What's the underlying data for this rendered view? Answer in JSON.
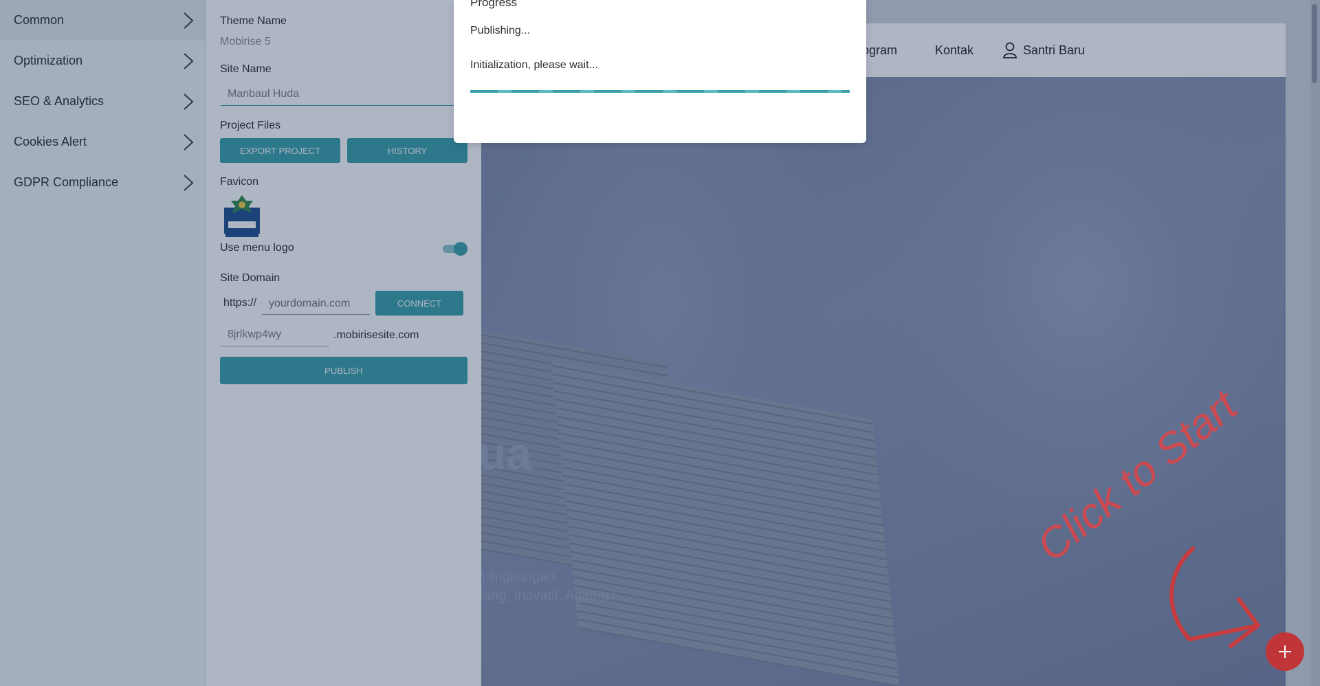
{
  "menu": {
    "items": [
      {
        "label": "Common"
      },
      {
        "label": "Optimization"
      },
      {
        "label": "SEO & Analytics"
      },
      {
        "label": "Cookies Alert"
      },
      {
        "label": "GDPR Compliance"
      }
    ]
  },
  "settings": {
    "theme_name_label": "Theme Name",
    "theme_name_value": "Mobirise 5",
    "site_name_label": "Site Name",
    "site_name_value": "Manbaul Huda",
    "project_files_label": "Project Files",
    "export_button": "EXPORT PROJECT",
    "history_button": "HISTORY",
    "favicon_label": "Favicon",
    "use_menu_logo_label": "Use menu logo",
    "use_menu_logo_on": true,
    "site_domain_label": "Site Domain",
    "domain_prefix": "https://",
    "domain_placeholder": "yourdomain.com",
    "connect_button": "CONNECT",
    "subdomain_value": "8jrlkwp4wy",
    "subdomain_suffix": ".mobirisesite.com",
    "publish_button": "PUBLISH"
  },
  "preview": {
    "nav": {
      "program": "rogram",
      "kontak": "Kontak",
      "santri_baru": "Santri Baru"
    },
    "hero_title": "ua",
    "hero_sub1": "n lingkungan",
    "hero_sub2": "dang, Inovatif, Agamis)",
    "click_to_start": "Click to Start"
  },
  "modal": {
    "title": "Progress",
    "status": "Publishing...",
    "message": "Initialization, please wait..."
  },
  "colors": {
    "accent": "#3aa1a9",
    "fab": "#bf3538"
  }
}
